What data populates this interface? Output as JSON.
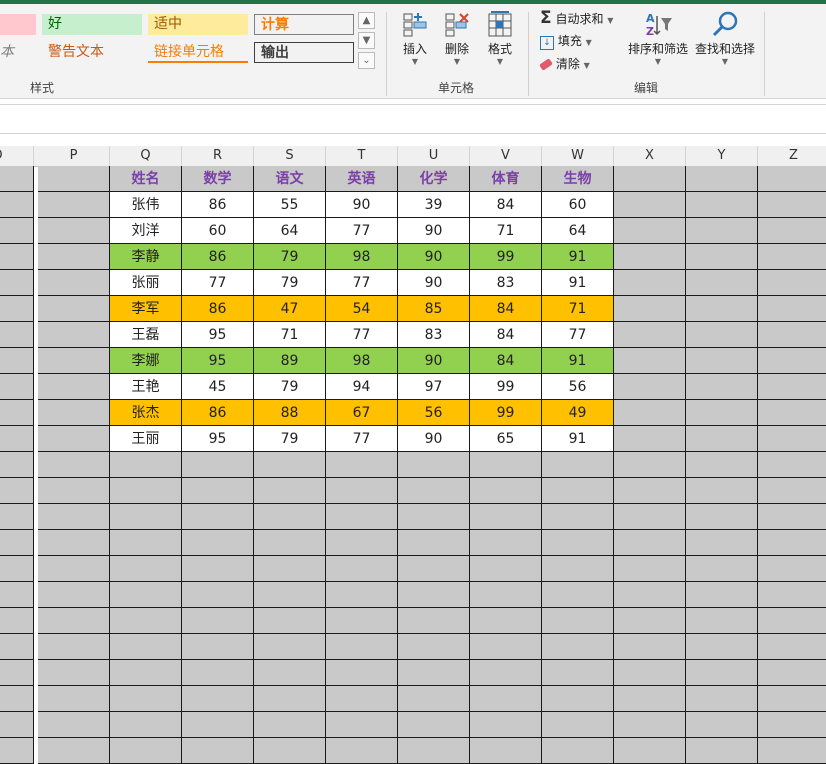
{
  "ribbon": {
    "styles": {
      "group_label": "样式",
      "items": [
        {
          "id": "bad",
          "label": "",
          "bg": "#ffc7ce",
          "color": "#9c0006"
        },
        {
          "id": "good",
          "label": "好",
          "bg": "#c6efce",
          "color": "#006100"
        },
        {
          "id": "neutral",
          "label": "适中",
          "bg": "#ffeb9c",
          "color": "#9c5700"
        },
        {
          "id": "calculation",
          "label": "计算",
          "bg": "#f2f2f2",
          "color": "#fa7d00"
        },
        {
          "id": "explanatory",
          "label": "本",
          "bg": "#f3f3f3",
          "color": "#7f7f7f"
        },
        {
          "id": "warning",
          "label": "警告文本",
          "bg": "#f3f3f3",
          "color": "#c65911"
        },
        {
          "id": "linked",
          "label": "链接单元格",
          "bg": "#f3f3f3",
          "color": "#fa7d00"
        },
        {
          "id": "output",
          "label": "输出",
          "bg": "#f2f2f2",
          "color": "#3f3f3f"
        }
      ]
    },
    "cells": {
      "group_label": "单元格",
      "insert": "插入",
      "delete": "删除",
      "format": "格式"
    },
    "editing": {
      "group_label": "编辑",
      "autosum": "自动求和",
      "fill": "填充",
      "clear": "清除",
      "sort_filter": "排序和筛选",
      "find_select": "查找和选择"
    }
  },
  "columns": [
    "O",
    "P",
    "Q",
    "R",
    "S",
    "T",
    "U",
    "V",
    "W",
    "X",
    "Y",
    "Z"
  ],
  "table": {
    "headers": [
      "姓名",
      "数学",
      "语文",
      "英语",
      "化学",
      "体育",
      "生物"
    ],
    "rows": [
      {
        "cells": [
          "张伟",
          "86",
          "55",
          "90",
          "39",
          "84",
          "60"
        ],
        "hl": ""
      },
      {
        "cells": [
          "刘洋",
          "60",
          "64",
          "77",
          "90",
          "71",
          "64"
        ],
        "hl": ""
      },
      {
        "cells": [
          "李静",
          "86",
          "79",
          "98",
          "90",
          "99",
          "91"
        ],
        "hl": "green"
      },
      {
        "cells": [
          "张丽",
          "77",
          "79",
          "77",
          "90",
          "83",
          "91"
        ],
        "hl": ""
      },
      {
        "cells": [
          "李军",
          "86",
          "47",
          "54",
          "85",
          "84",
          "71"
        ],
        "hl": "orange"
      },
      {
        "cells": [
          "王磊",
          "95",
          "71",
          "77",
          "83",
          "84",
          "77"
        ],
        "hl": ""
      },
      {
        "cells": [
          "李娜",
          "95",
          "89",
          "98",
          "90",
          "84",
          "91"
        ],
        "hl": "green"
      },
      {
        "cells": [
          "王艳",
          "45",
          "79",
          "94",
          "97",
          "99",
          "56"
        ],
        "hl": ""
      },
      {
        "cells": [
          "张杰",
          "86",
          "88",
          "67",
          "56",
          "99",
          "49"
        ],
        "hl": "orange"
      },
      {
        "cells": [
          "王丽",
          "95",
          "79",
          "77",
          "90",
          "65",
          "91"
        ],
        "hl": ""
      }
    ],
    "empty_rows": 12
  },
  "colors": {
    "accent": "#217346",
    "header_text": "#7b3fa8",
    "green": "#92d050",
    "orange": "#ffc000",
    "empty_cell": "#c9c9c9"
  }
}
